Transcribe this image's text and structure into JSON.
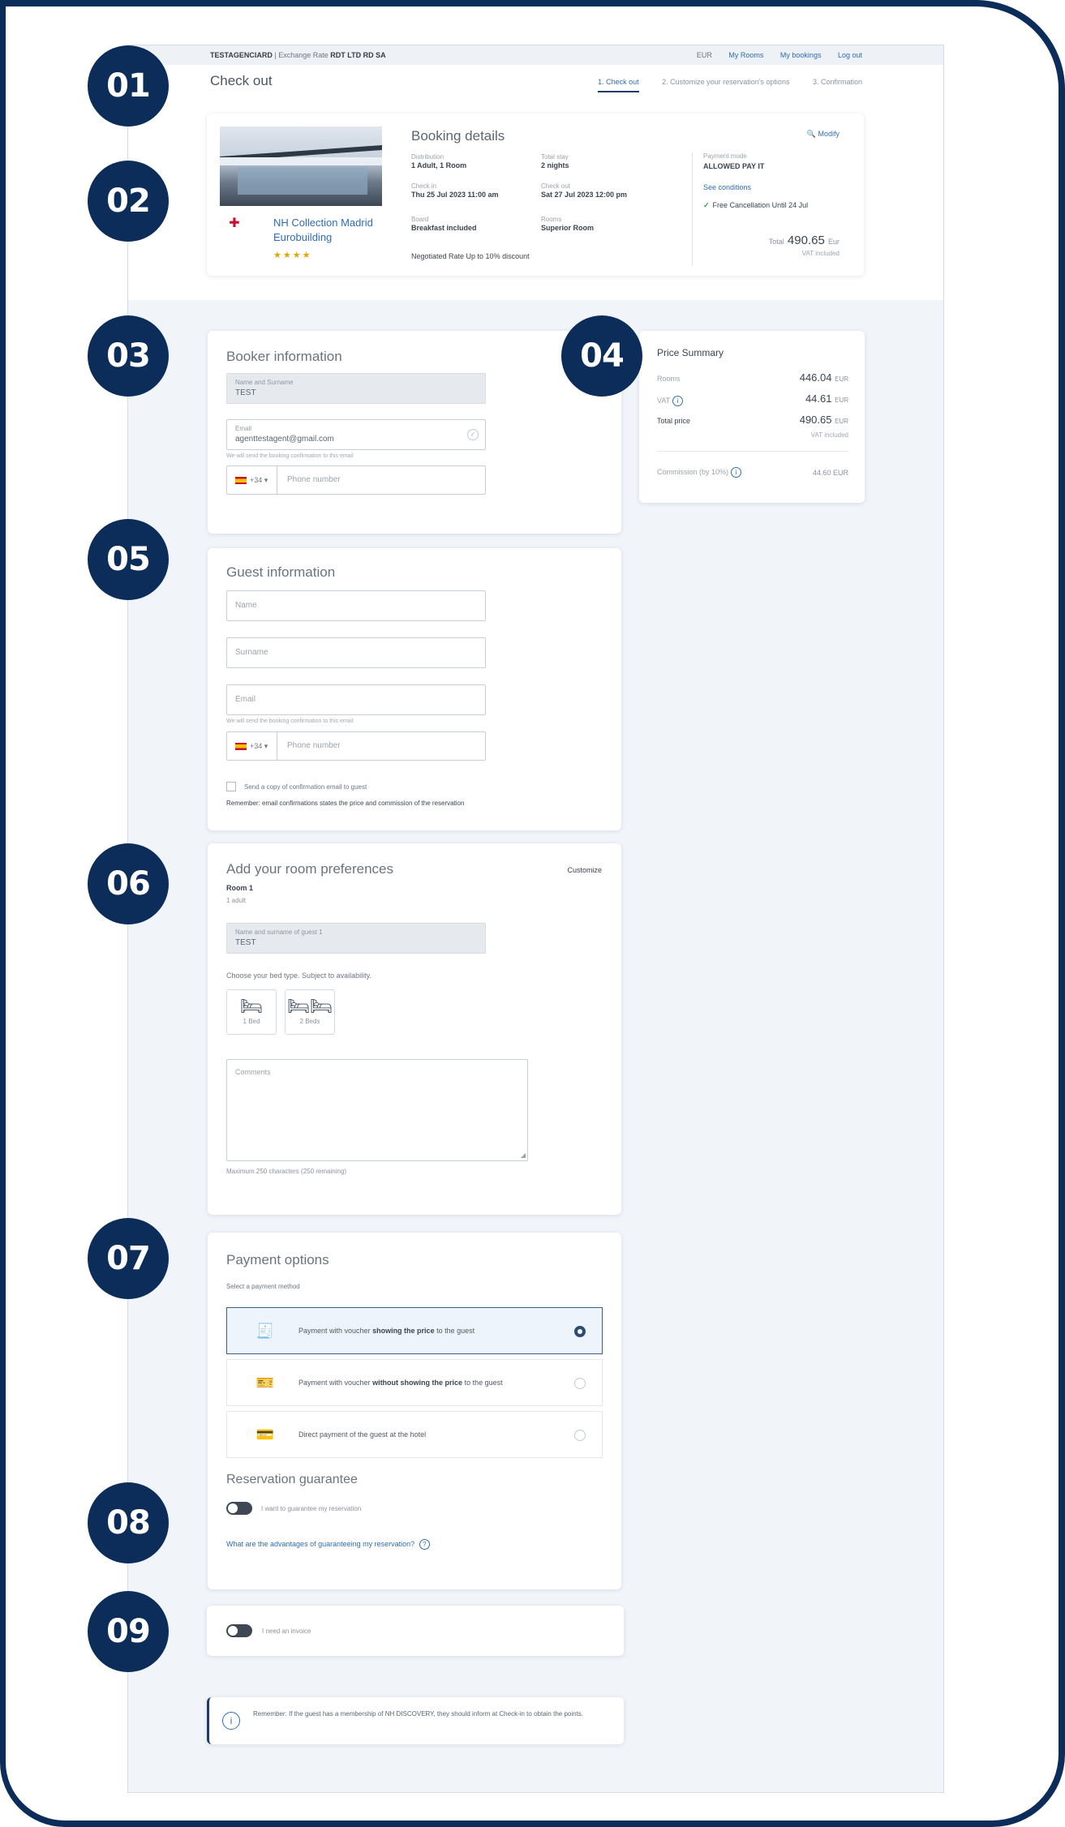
{
  "topbar": {
    "agency": "TESTAGENCIARD",
    "separator": "|",
    "exch_label": "Exchange Rate",
    "exch_value": "RDT LTD RD SA",
    "currency": "EUR",
    "my_rooms": "My Rooms",
    "my_bookings": "My bookings",
    "logout": "Log out"
  },
  "page": {
    "title": "Check out",
    "steps": [
      "1. Check out",
      "2. Customize your reservation's options",
      "3. Confirmation"
    ]
  },
  "booking": {
    "title": "Booking details",
    "modify": "Modify",
    "hotel_name": "NH Collection Madrid Eurobuilding",
    "stars": "★★★★",
    "distribution_label": "Distribution",
    "distribution_value": "1 Adult, 1 Room",
    "stay_label": "Total stay",
    "stay_value": "2 nights",
    "checkin_label": "Check in",
    "checkin_value": "Thu 25 Jul 2023 11:00 am",
    "checkout_label": "Check out",
    "checkout_value": "Sat 27 Jul 2023 12:00 pm",
    "board_label": "Board",
    "board_value": "Breakfast included",
    "rooms_label": "Rooms",
    "rooms_value": "Superior Room",
    "negotiated": "Negotiated Rate Up to 10% discount",
    "payment_label": "Payment mode",
    "payment_value": "ALLOWED PAY IT",
    "see_conditions": "See conditions",
    "free_cancel": "Free Cancellation Until 24 Jul",
    "price_prefix": "Total",
    "price": "490.65",
    "price_currency": "Eur",
    "vat": "VAT included"
  },
  "booker": {
    "title": "Booker information",
    "name_label": "Name and Surname",
    "name_value": "TEST",
    "email_label": "Email",
    "email_value": "agenttestagent@gmail.com",
    "email_hint": "We will send the booking confirmation to this email",
    "phone_cc": "+34",
    "phone_placeholder": "Phone number"
  },
  "summary": {
    "title": "Price Summary",
    "rooms_label": "Rooms",
    "rooms_value": "446.04",
    "vat_label": "VAT",
    "vat_value": "44.61",
    "total_label": "Total price",
    "total_value": "490.65",
    "currency": "EUR",
    "total_sub": "VAT included",
    "commission_label": "Commission (by 10%)",
    "commission_value": "44.60 EUR"
  },
  "guest": {
    "title": "Guest information",
    "name_ph": "Name",
    "surname_ph": "Surname",
    "email_ph": "Email",
    "email_hint": "We will send the booking confirmation to this email",
    "phone_cc": "+34",
    "phone_placeholder": "Phone number",
    "send_copy": "Send a copy of confirmation email to guest",
    "remember": "Remember: email confirmations states the price and commission of the reservation"
  },
  "prefs": {
    "title": "Add your room preferences",
    "customize": "Customize",
    "room": "Room 1",
    "adult": "1 adult",
    "name_label": "Name and surname of guest 1",
    "name_value": "TEST",
    "bed_question": "Choose your bed type. Subject to availability.",
    "bed1": "1 Bed",
    "bed2": "2 Beds",
    "comments_ph": "Comments",
    "max_chars": "Maximum 250 characters (250 remaining)"
  },
  "payment": {
    "title": "Payment options",
    "subtitle": "Select a payment method",
    "opt1_pre": "Payment with voucher",
    "opt1_bold": "showing the price",
    "opt1_post": "to the guest",
    "opt2_pre": "Payment with voucher",
    "opt2_bold": "without showing the price",
    "opt2_post": "to the guest",
    "opt3": "Direct payment of the guest at the hotel",
    "guarantee_title": "Reservation guarantee",
    "guarantee_toggle": "I want to guarantee my reservation",
    "guarantee_link": "What are the advantages of guaranteeing my reservation?"
  },
  "invoice": {
    "label": "I need an invoice"
  },
  "note": {
    "text": "Remember: If the guest has a membership of NH DISCOVERY, they should inform at Check-in to obtain the points."
  },
  "markers": [
    "01",
    "02",
    "03",
    "04",
    "05",
    "06",
    "07",
    "08",
    "09"
  ],
  "colors": {
    "navy": "#0c2d5a",
    "link": "#2f6db5",
    "check": "#2d9b4c",
    "star": "#e3a500"
  }
}
